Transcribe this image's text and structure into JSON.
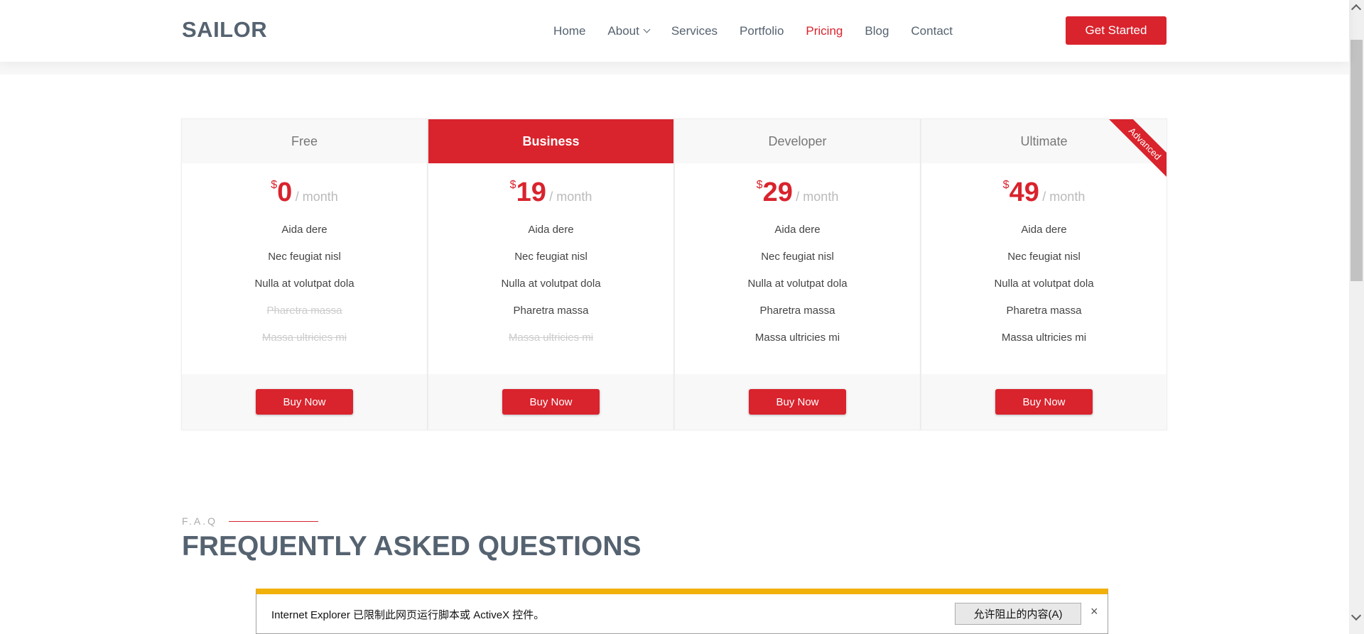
{
  "header": {
    "logo": "SAILOR",
    "nav": [
      {
        "label": "Home",
        "active": false
      },
      {
        "label": "About",
        "active": false,
        "dropdown": true
      },
      {
        "label": "Services",
        "active": false
      },
      {
        "label": "Portfolio",
        "active": false
      },
      {
        "label": "Pricing",
        "active": true
      },
      {
        "label": "Blog",
        "active": false
      },
      {
        "label": "Contact",
        "active": false
      }
    ],
    "cta_label": "Get Started"
  },
  "pricing": {
    "plans": [
      {
        "name": "Free",
        "currency": "$",
        "amount": "0",
        "period": "/ month",
        "features": [
          {
            "text": "Aida dere",
            "included": true
          },
          {
            "text": "Nec feugiat nisl",
            "included": true
          },
          {
            "text": "Nulla at volutpat dola",
            "included": true
          },
          {
            "text": "Pharetra massa",
            "included": false
          },
          {
            "text": "Massa ultricies mi",
            "included": false
          }
        ],
        "button": "Buy Now"
      },
      {
        "name": "Business",
        "currency": "$",
        "amount": "19",
        "period": "/ month",
        "features": [
          {
            "text": "Aida dere",
            "included": true
          },
          {
            "text": "Nec feugiat nisl",
            "included": true
          },
          {
            "text": "Nulla at volutpat dola",
            "included": true
          },
          {
            "text": "Pharetra massa",
            "included": true
          },
          {
            "text": "Massa ultricies mi",
            "included": false
          }
        ],
        "button": "Buy Now"
      },
      {
        "name": "Developer",
        "currency": "$",
        "amount": "29",
        "period": "/ month",
        "features": [
          {
            "text": "Aida dere",
            "included": true
          },
          {
            "text": "Nec feugiat nisl",
            "included": true
          },
          {
            "text": "Nulla at volutpat dola",
            "included": true
          },
          {
            "text": "Pharetra massa",
            "included": true
          },
          {
            "text": "Massa ultricies mi",
            "included": true
          }
        ],
        "button": "Buy Now"
      },
      {
        "name": "Ultimate",
        "currency": "$",
        "amount": "49",
        "period": "/ month",
        "ribbon": "Advanced",
        "features": [
          {
            "text": "Aida dere",
            "included": true
          },
          {
            "text": "Nec feugiat nisl",
            "included": true
          },
          {
            "text": "Nulla at volutpat dola",
            "included": true
          },
          {
            "text": "Pharetra massa",
            "included": true
          },
          {
            "text": "Massa ultricies mi",
            "included": true
          }
        ],
        "button": "Buy Now"
      }
    ]
  },
  "faq": {
    "label": "F.A.Q",
    "title": "FREQUENTLY ASKED QUESTIONS"
  },
  "infobar": {
    "message": "Internet Explorer 已限制此网页运行脚本或 ActiveX 控件。",
    "allow_button": "允许阻止的内容(A)",
    "close": "×"
  },
  "colors": {
    "accent": "#d9232d",
    "heading": "#556270",
    "infobar_stripe": "#f2b00a"
  }
}
